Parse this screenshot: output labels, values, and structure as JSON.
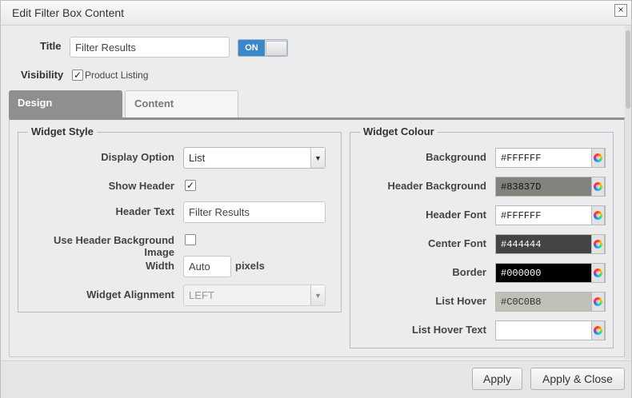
{
  "dialog": {
    "title": "Edit Filter Box Content",
    "close_glyph": "×"
  },
  "general": {
    "title_label": "Title",
    "title_value": "Filter Results",
    "toggle_label": "ON",
    "visibility_label": "Visibility",
    "visibility_option_label": "Product Listing",
    "visibility_checked_glyph": "✓"
  },
  "tabs": [
    {
      "label": "Design",
      "active": true
    },
    {
      "label": "Content",
      "active": false
    }
  ],
  "widget_style": {
    "legend": "Widget Style",
    "display_option_label": "Display Option",
    "display_option_value": "List",
    "show_header_label": "Show Header",
    "show_header_glyph": "✓",
    "header_text_label": "Header Text",
    "header_text_value": "Filter Results",
    "use_bg_image_label": "Use Header Background Image",
    "width_label": "Width",
    "width_value": "Auto",
    "width_unit": "pixels",
    "alignment_label": "Widget Alignment",
    "alignment_value": "LEFT",
    "dropdown_glyph": "▼"
  },
  "widget_colour": {
    "legend": "Widget Colour",
    "rows": [
      {
        "label": "Background",
        "value": "#FFFFFF",
        "bg": "#FFFFFF",
        "fg": "#222222"
      },
      {
        "label": "Header Background",
        "value": "#83837D",
        "bg": "#83837D",
        "fg": "#111111"
      },
      {
        "label": "Header Font",
        "value": "#FFFFFF",
        "bg": "#FFFFFF",
        "fg": "#222222"
      },
      {
        "label": "Center Font",
        "value": "#444444",
        "bg": "#444444",
        "fg": "#FFFFFF"
      },
      {
        "label": "Border",
        "value": "#000000",
        "bg": "#000000",
        "fg": "#FFFFFF"
      },
      {
        "label": "List Hover",
        "value": "#C0C0B8",
        "bg": "#C0C0B8",
        "fg": "#333333"
      },
      {
        "label": "List Hover Text",
        "value": "",
        "bg": "#FFFFFF",
        "fg": "#222222"
      }
    ]
  },
  "footer": {
    "apply_label": "Apply",
    "apply_close_label": "Apply & Close"
  },
  "colors": {
    "accent": "#3A87C9",
    "tab_active": "#8F8F8F"
  }
}
